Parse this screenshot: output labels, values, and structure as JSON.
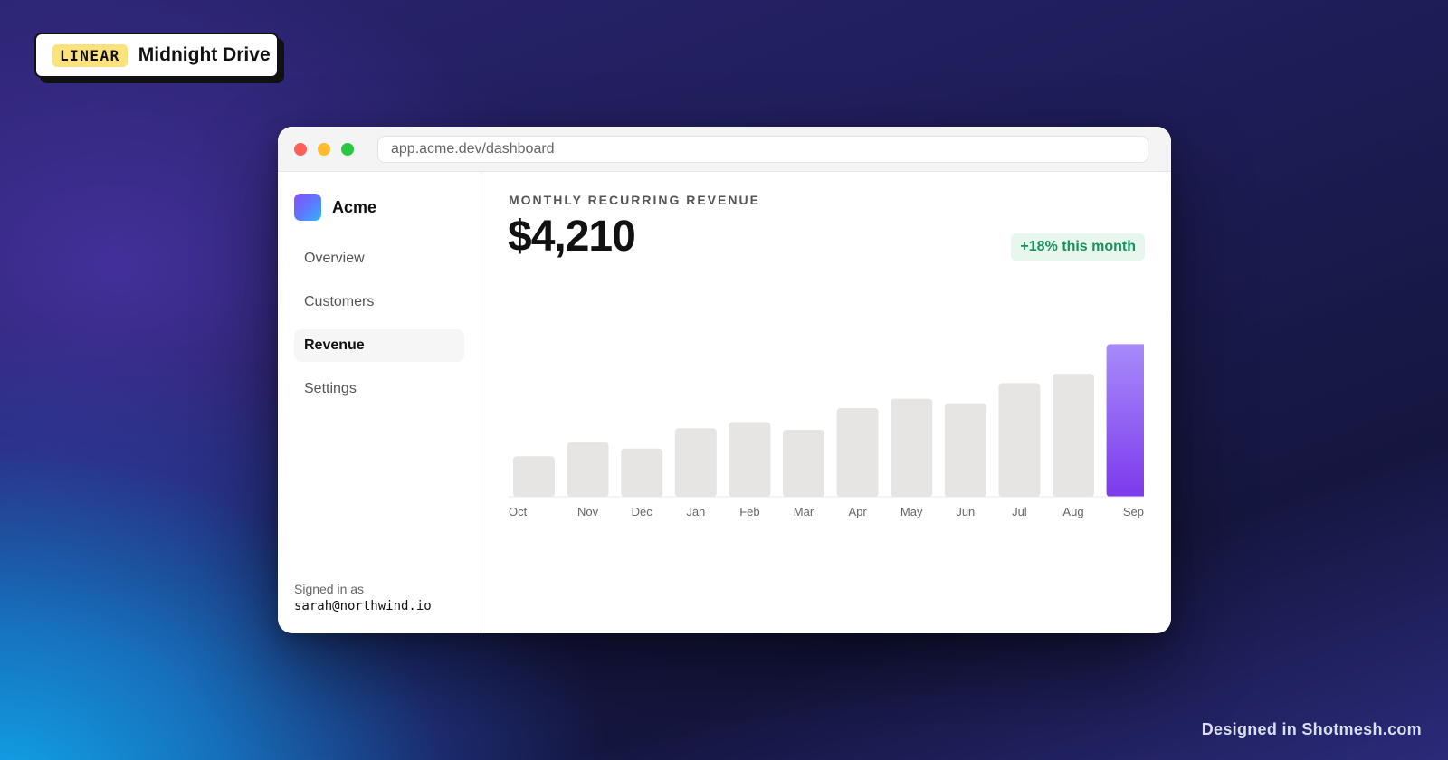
{
  "badge": {
    "tag": "LINEAR",
    "title": "Midnight Drive"
  },
  "window": {
    "url": "app.acme.dev/dashboard"
  },
  "sidebar": {
    "brand": "Acme",
    "items": [
      {
        "label": "Overview",
        "active": false
      },
      {
        "label": "Customers",
        "active": false
      },
      {
        "label": "Revenue",
        "active": true
      },
      {
        "label": "Settings",
        "active": false
      }
    ],
    "signed_in_label": "Signed in as",
    "signed_in_email": "sarah@northwind.io"
  },
  "main": {
    "metric_label": "MONTHLY RECURRING REVENUE",
    "metric_value": "$4,210",
    "delta_badge": "+18% this month"
  },
  "chart_data": {
    "type": "bar",
    "categories": [
      "Oct",
      "Nov",
      "Dec",
      "Jan",
      "Feb",
      "Mar",
      "Apr",
      "May",
      "Jun",
      "Jul",
      "Aug",
      "Sep"
    ],
    "values": [
      26,
      35,
      31,
      44,
      48,
      43,
      57,
      63,
      60,
      73,
      79,
      98
    ],
    "ylim": [
      0,
      100
    ],
    "highlight_index": 11,
    "colors": {
      "bar": "#e6e5e4",
      "highlight_top": "#a78bfa",
      "highlight_bottom": "#7c3aed"
    }
  },
  "footer": {
    "credit": "Designed in Shotmesh.com"
  }
}
